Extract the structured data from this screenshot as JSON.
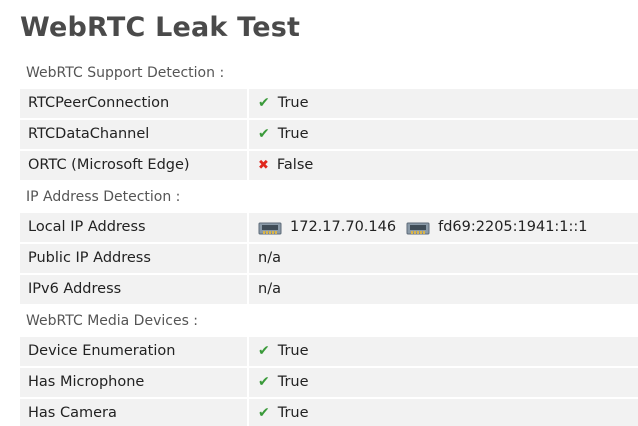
{
  "title": "WebRTC Leak Test",
  "sections": {
    "support": {
      "heading": "WebRTC Support Detection :",
      "rows": [
        {
          "label": "RTCPeerConnection",
          "mark": "✔",
          "value": "True"
        },
        {
          "label": "RTCDataChannel",
          "mark": "✔",
          "value": "True"
        },
        {
          "label": "ORTC (Microsoft Edge)",
          "mark": "✖",
          "value": "False"
        }
      ]
    },
    "ip": {
      "heading": "IP Address Detection :",
      "local": {
        "label": "Local IP Address",
        "ipv4": "172.17.70.146",
        "ipv6": "fd69:2205:1941:1::1"
      },
      "public": {
        "label": "Public IP Address",
        "value": "n/a"
      },
      "ipv6": {
        "label": "IPv6 Address",
        "value": "n/a"
      }
    },
    "media": {
      "heading": "WebRTC Media Devices :",
      "rows": [
        {
          "label": "Device Enumeration",
          "mark": "✔",
          "value": "True"
        },
        {
          "label": "Has Microphone",
          "mark": "✔",
          "value": "True"
        },
        {
          "label": "Has Camera",
          "mark": "✔",
          "value": "True"
        }
      ]
    }
  },
  "icons": {
    "true_icon": "check-icon",
    "false_icon": "cross-icon",
    "network_icon": "network-card-icon"
  },
  "colors": {
    "true": "#3a9a3a",
    "false": "#e0261c",
    "row_background": "#f2f2f2"
  }
}
